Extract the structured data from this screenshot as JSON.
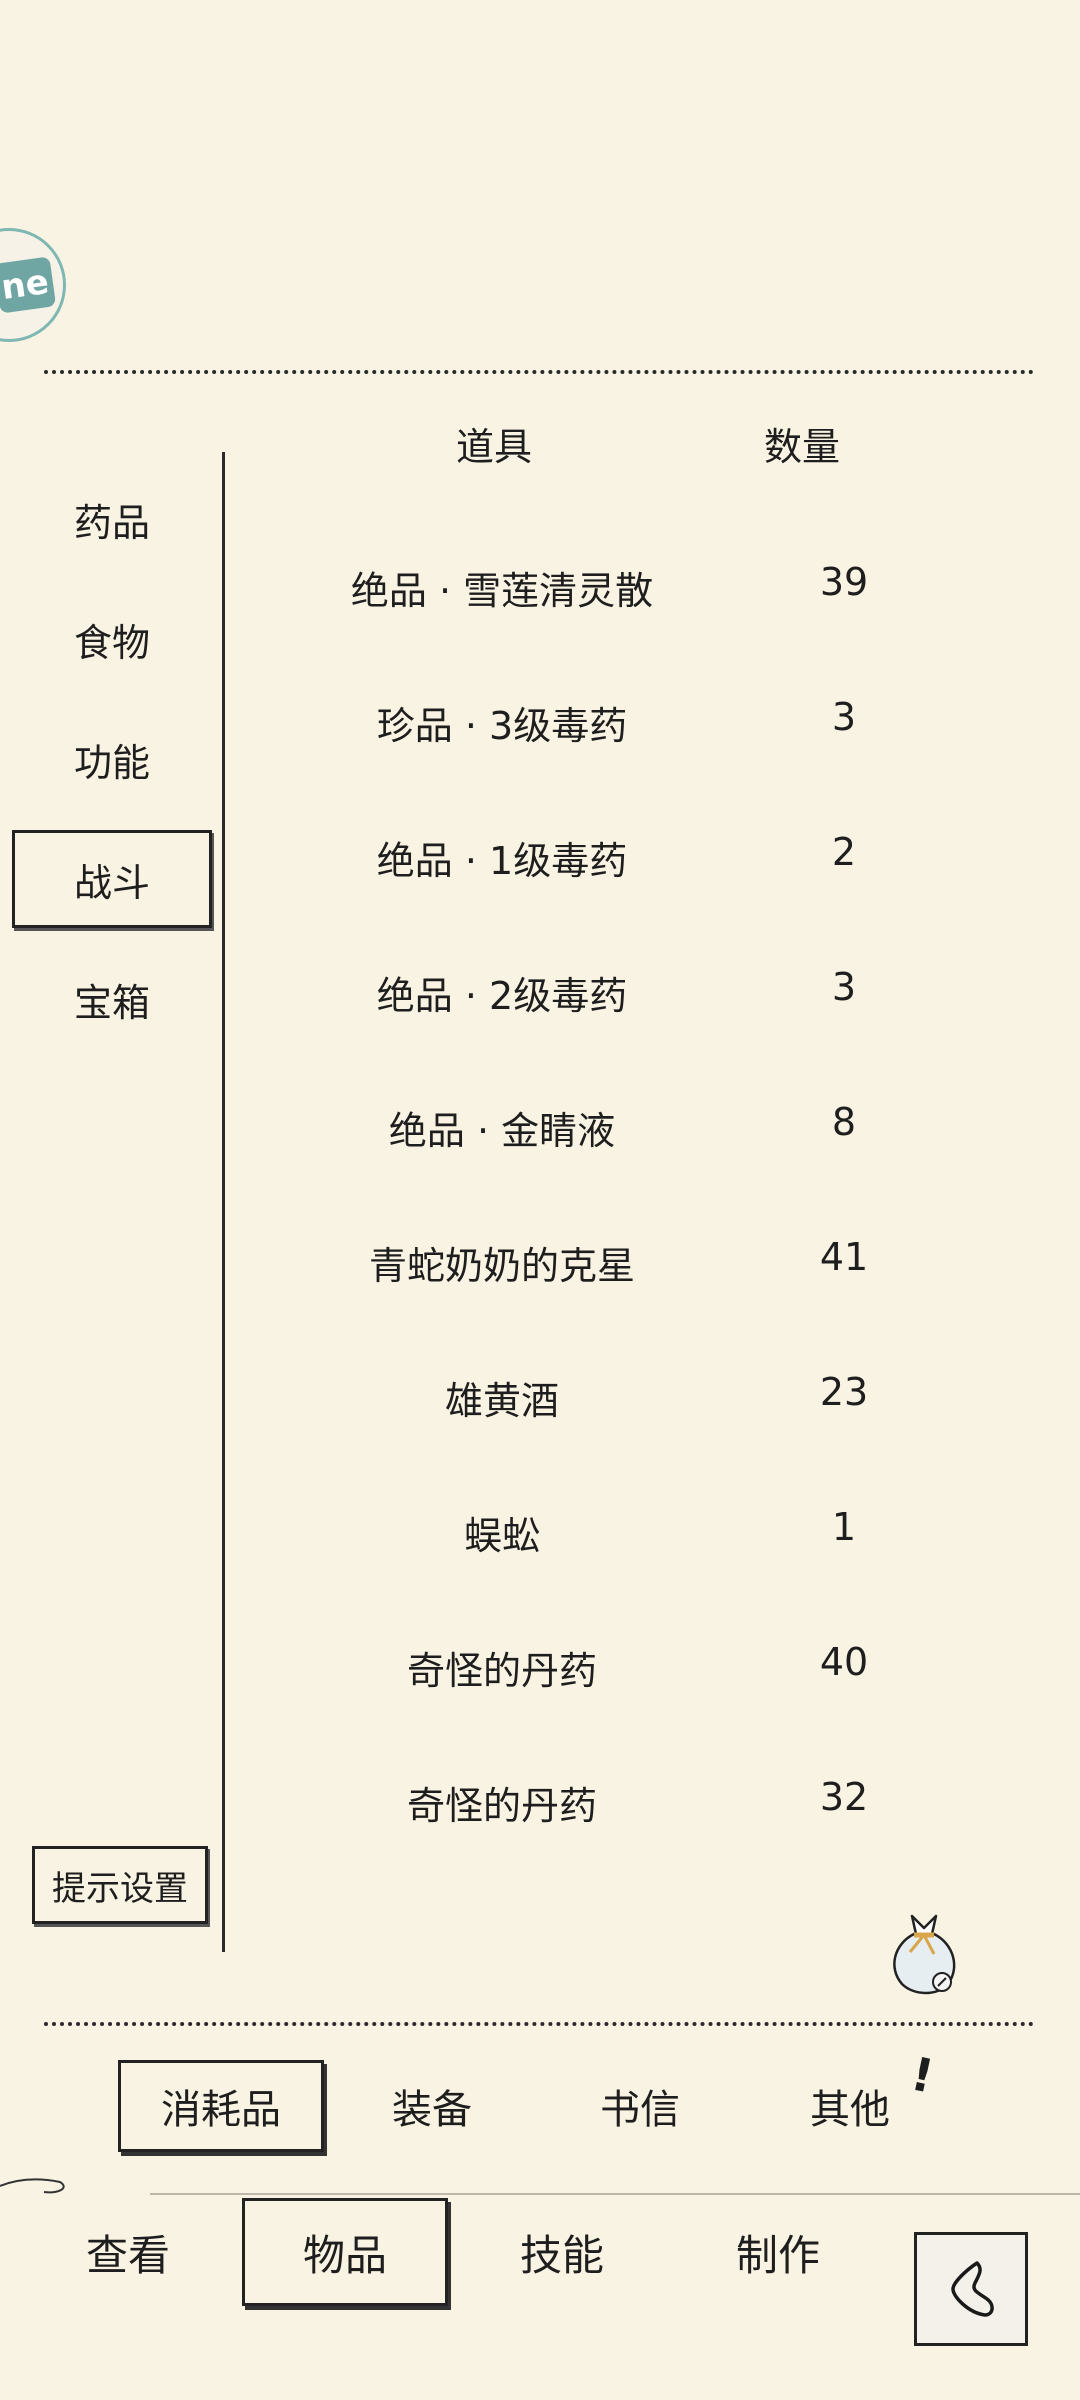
{
  "floating_button": {
    "badge_text": "ne"
  },
  "table": {
    "header_item": "道具",
    "header_qty": "数量",
    "rows": [
      {
        "name": "绝品 · 雪莲清灵散",
        "qty": "39"
      },
      {
        "name": "珍品 · 3级毒药",
        "qty": "3"
      },
      {
        "name": "绝品 · 1级毒药",
        "qty": "2"
      },
      {
        "name": "绝品 · 2级毒药",
        "qty": "3"
      },
      {
        "name": "绝品 · 金睛液",
        "qty": "8"
      },
      {
        "name": "青蛇奶奶的克星",
        "qty": "41"
      },
      {
        "name": "雄黄酒",
        "qty": "23"
      },
      {
        "name": "蜈蚣",
        "qty": "1"
      },
      {
        "name": "奇怪的丹药",
        "qty": "40"
      },
      {
        "name": "奇怪的丹药",
        "qty": "32"
      }
    ]
  },
  "categories": [
    {
      "label": "药品",
      "active": false
    },
    {
      "label": "食物",
      "active": false
    },
    {
      "label": "功能",
      "active": false
    },
    {
      "label": "战斗",
      "active": true
    },
    {
      "label": "宝箱",
      "active": false
    }
  ],
  "hint_settings_label": "提示设置",
  "sub_tabs": [
    {
      "label": "消耗品",
      "active": true
    },
    {
      "label": "装备",
      "active": false
    },
    {
      "label": "书信",
      "active": false
    },
    {
      "label": "其他",
      "active": false
    }
  ],
  "bottom_tabs": [
    {
      "label": "查看",
      "active": false
    },
    {
      "label": "物品",
      "active": true
    },
    {
      "label": "技能",
      "active": false
    },
    {
      "label": "制作",
      "active": false
    }
  ],
  "exclaim_mark": "!",
  "icons": {
    "floating": "app-badge-icon",
    "bag": "item-bag-icon",
    "back": "back-arrow-icon"
  }
}
